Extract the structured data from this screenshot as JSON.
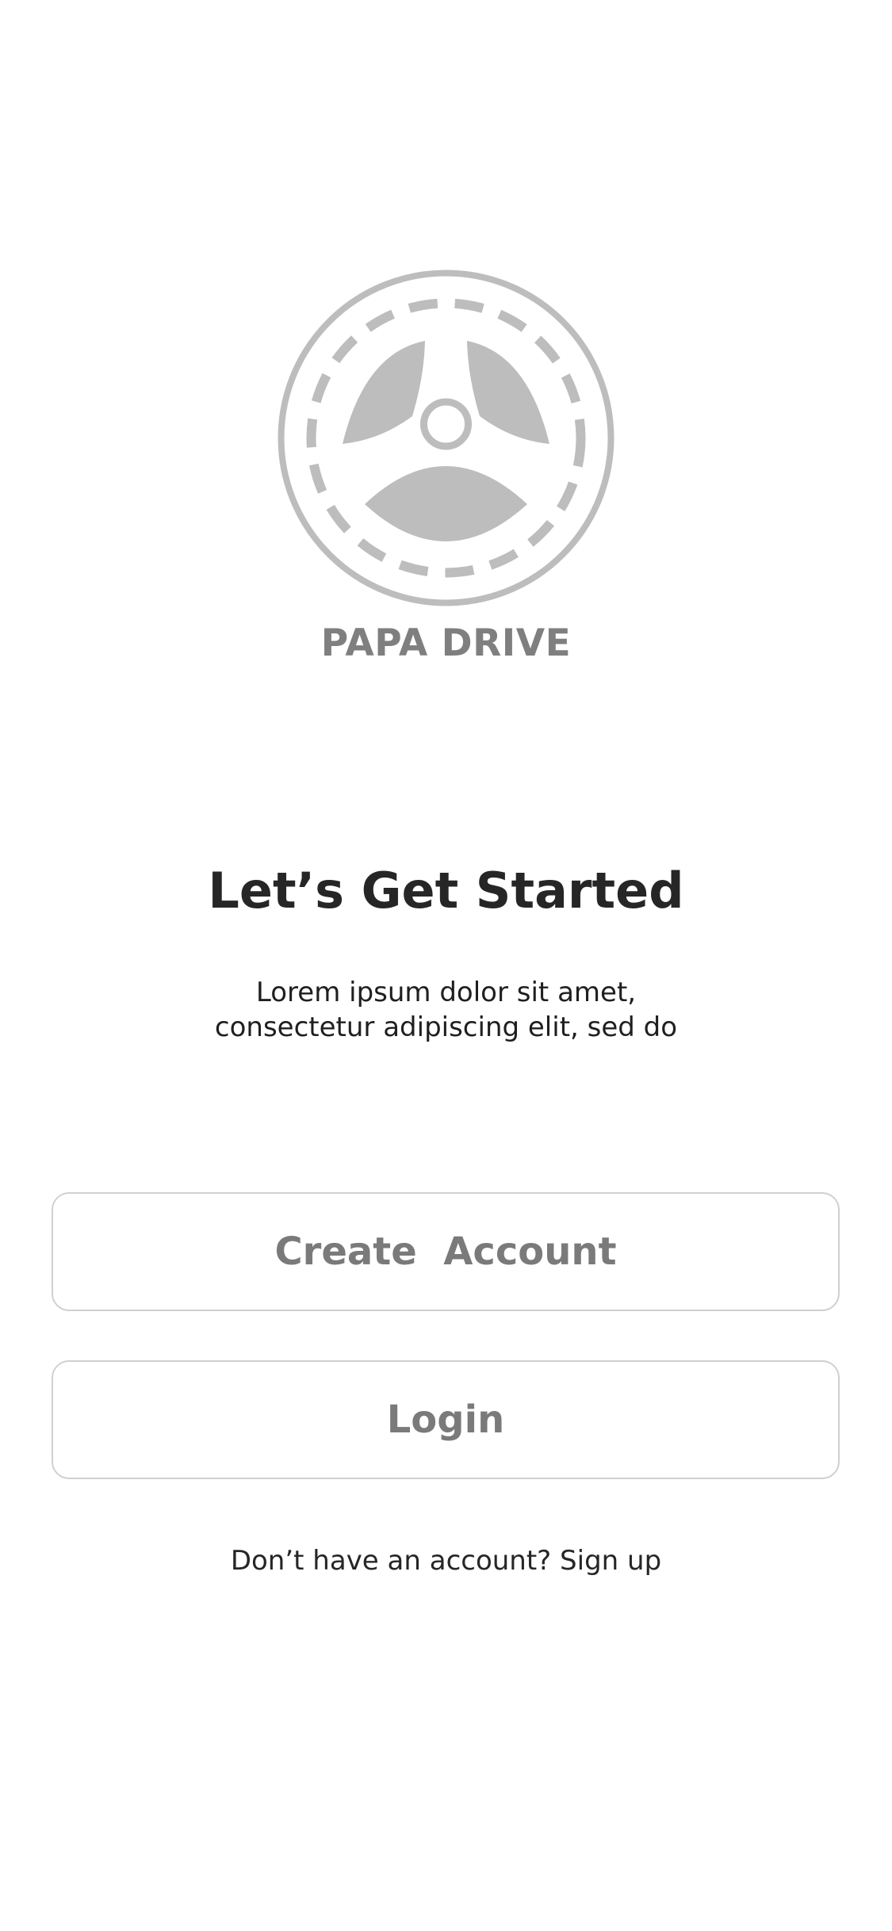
{
  "logo": {
    "icon": "steering-wheel-icon",
    "color": "#bdbdbd",
    "brand_name": "PAPA DRIVE"
  },
  "intro": {
    "headline": "Let’s Get Started",
    "subtext_lines": [
      "Lorem ipsum dolor sit amet,",
      "consectetur adipiscing elit, sed do"
    ]
  },
  "actions": {
    "create_account_label": "Create  Account",
    "login_label": "Login"
  },
  "footer": {
    "prompt": "Don’t have an account?",
    "signup_label": "Sign up"
  },
  "colors": {
    "background": "#ffffff",
    "logo_gray": "#bdbdbd",
    "brand_text": "#7f7f7f",
    "headline_text": "#262626",
    "button_border": "#d0d0d0",
    "button_text": "#7a7a7a"
  }
}
